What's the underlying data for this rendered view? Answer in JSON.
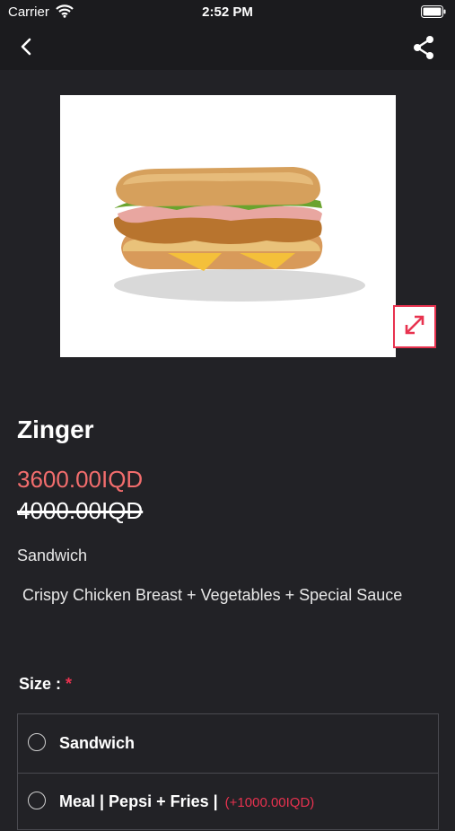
{
  "status_bar": {
    "carrier": "Carrier",
    "time": "2:52 PM"
  },
  "product": {
    "name": "Zinger",
    "price": "3600.00IQD",
    "old_price": "4000.00IQD",
    "category": "Sandwich",
    "description": "Crispy Chicken Breast + Vegetables + Special Sauce"
  },
  "size": {
    "label": "Size :",
    "required_mark": "*",
    "options": [
      {
        "label": "Sandwich",
        "extra": ""
      },
      {
        "label": "Meal | Pepsi + Fries |",
        "extra": "(+1000.00IQD)"
      }
    ]
  },
  "colors": {
    "accent": "#e8324f",
    "price": "#f26d6d",
    "background": "#222226"
  },
  "icons": [
    "wifi-icon",
    "battery-icon",
    "back-chevron-icon",
    "share-icon",
    "expand-icon"
  ]
}
